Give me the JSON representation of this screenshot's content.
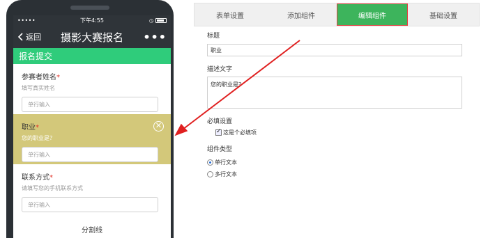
{
  "phone": {
    "status": {
      "carrier": "•••••",
      "time": "下午4:55"
    },
    "nav": {
      "back_label": "返回",
      "title": "摄影大赛报名",
      "more": "•••"
    },
    "section_title": "报名提交",
    "fields": [
      {
        "label": "参赛者姓名",
        "required": "*",
        "desc": "填写真实姓名",
        "placeholder": "单行输入"
      },
      {
        "label": "职业",
        "required": "*",
        "desc": "您的职业是？",
        "placeholder": "单行输入",
        "close": "✕"
      },
      {
        "label": "联系方式",
        "required": "*",
        "desc": "请填写您的手机联系方式",
        "placeholder": "单行输入"
      }
    ],
    "divider_label": "分割线"
  },
  "tabs": [
    {
      "label": "表单设置"
    },
    {
      "label": "添加组件"
    },
    {
      "label": "编辑组件"
    },
    {
      "label": "基础设置"
    }
  ],
  "editor": {
    "title_label": "标题",
    "title_value": "职业",
    "desc_label": "描述文字",
    "desc_value": "您的职业是？",
    "required_label": "必填设置",
    "required_option": "这是个必填项",
    "type_label": "组件类型",
    "type_options": [
      "单行文本",
      "多行文本"
    ]
  },
  "colors": {
    "accent_green": "#2fcc7b",
    "tab_active": "#3db45c",
    "highlight": "#d3c87a",
    "arrow_red": "#e02020"
  }
}
